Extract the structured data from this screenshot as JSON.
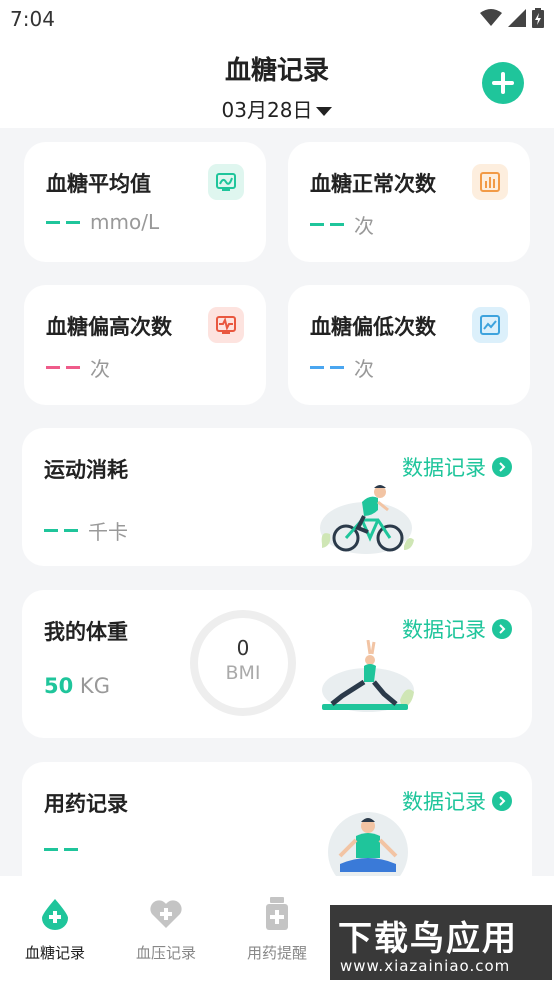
{
  "status": {
    "time": "7:04"
  },
  "header": {
    "title": "血糖记录",
    "date": "03月28日"
  },
  "stats": [
    {
      "title": "血糖平均值",
      "value": "mmo/L",
      "dash_color": "#1fc59b",
      "icon": "monitor-icon"
    },
    {
      "title": "血糖正常次数",
      "value": "次",
      "dash_color": "#1fc59b",
      "icon": "bar-chart-icon"
    },
    {
      "title": "血糖偏高次数",
      "value": "次",
      "dash_color": "#ef5b8a",
      "icon": "pulse-icon"
    },
    {
      "title": "血糖偏低次数",
      "value": "次",
      "dash_color": "#4aa6f0",
      "icon": "line-chart-icon"
    }
  ],
  "exercise": {
    "title": "运动消耗",
    "link": "数据记录",
    "unit": "千卡"
  },
  "weight": {
    "title": "我的体重",
    "link": "数据记录",
    "value": "50",
    "unit": "KG",
    "bmi_value": "0",
    "bmi_label": "BMI"
  },
  "medication": {
    "title": "用药记录",
    "link": "数据记录"
  },
  "tabs": [
    {
      "label": "血糖记录",
      "active": true
    },
    {
      "label": "血压记录",
      "active": false
    },
    {
      "label": "用药提醒",
      "active": false
    }
  ],
  "watermark": {
    "main": "下载鸟应用",
    "url": "www.xiazainiao.com"
  },
  "colors": {
    "accent": "#1fc59b",
    "high": "#ef5b8a",
    "low": "#4aa6f0"
  }
}
